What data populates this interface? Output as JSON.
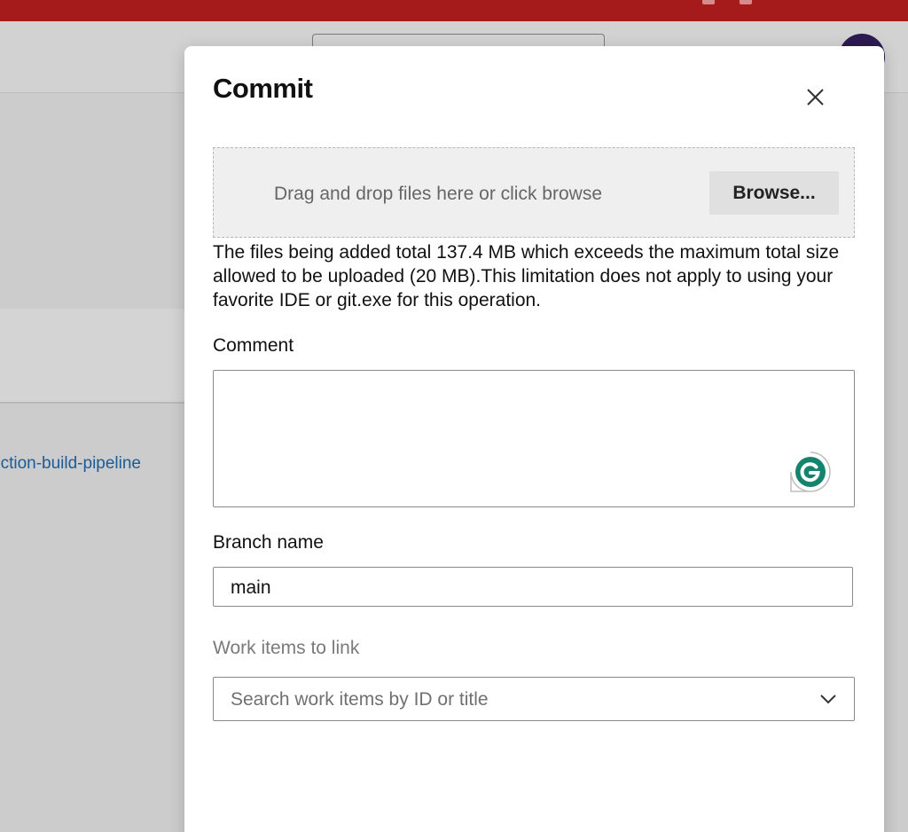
{
  "background": {
    "link_text": "nction-build-pipeline"
  },
  "dialog": {
    "title": "Commit",
    "dropzone": {
      "text": "Drag and drop files here or click browse",
      "browse_label": "Browse..."
    },
    "size_warning": "The files being added total 137.4 MB which exceeds the maximum total size allowed to be uploaded (20 MB).This limitation does not apply to using your favorite IDE or git.exe for this operation.",
    "comment": {
      "label": "Comment",
      "value": ""
    },
    "branch": {
      "label": "Branch name",
      "value": "main"
    },
    "work_items": {
      "label": "Work items to link",
      "placeholder": "Search work items by ID or title"
    }
  },
  "colors": {
    "top_bar": "#a51a1a",
    "link": "#1a5c99",
    "avatar": "#2c1a52",
    "grammarly": "#15846e"
  }
}
